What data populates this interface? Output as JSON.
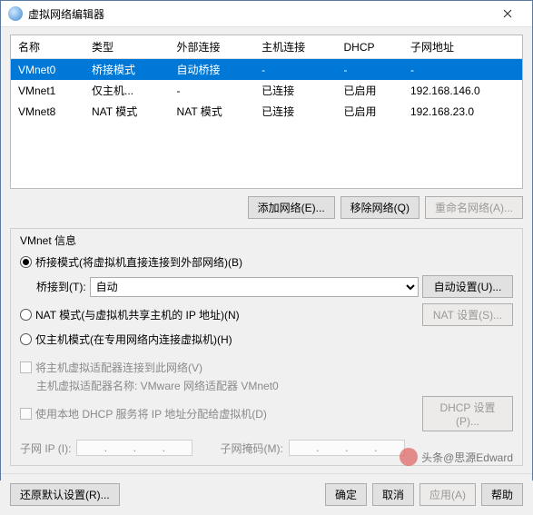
{
  "window": {
    "title": "虚拟网络编辑器"
  },
  "table": {
    "headers": [
      "名称",
      "类型",
      "外部连接",
      "主机连接",
      "DHCP",
      "子网地址"
    ],
    "rows": [
      {
        "cells": [
          "VMnet0",
          "桥接模式",
          "自动桥接",
          "-",
          "-",
          "-"
        ],
        "selected": true
      },
      {
        "cells": [
          "VMnet1",
          "仅主机...",
          "-",
          "已连接",
          "已启用",
          "192.168.146.0"
        ],
        "selected": false
      },
      {
        "cells": [
          "VMnet8",
          "NAT 模式",
          "NAT 模式",
          "已连接",
          "已启用",
          "192.168.23.0"
        ],
        "selected": false
      }
    ]
  },
  "rowButtons": {
    "add": "添加网络(E)...",
    "remove": "移除网络(Q)",
    "rename": "重命名网络(A)..."
  },
  "group": {
    "title": "VMnet 信息",
    "bridge": {
      "label": "桥接模式(将虚拟机直接连接到外部网络)(B)",
      "to": "桥接到(T):",
      "auto": "自动",
      "autoset": "自动设置(U)..."
    },
    "nat": {
      "label": "NAT 模式(与虚拟机共享主机的 IP 地址)(N)",
      "natset": "NAT 设置(S)..."
    },
    "host": {
      "label": "仅主机模式(在专用网络内连接虚拟机)(H)"
    },
    "connectHost": {
      "label": "将主机虚拟适配器连接到此网络(V)",
      "sub": "主机虚拟适配器名称: VMware 网络适配器 VMnet0"
    },
    "dhcp": {
      "label": "使用本地 DHCP 服务将 IP 地址分配给虚拟机(D)",
      "dhcpset": "DHCP 设置(P)..."
    },
    "ip": {
      "subnet": "子网 IP (I):",
      "mask": "子网掩码(M):"
    }
  },
  "footer": {
    "restore": "还原默认设置(R)...",
    "ok": "确定",
    "cancel": "取消",
    "apply": "应用(A)",
    "help": "帮助"
  },
  "watermark": "头条@思源Edward"
}
